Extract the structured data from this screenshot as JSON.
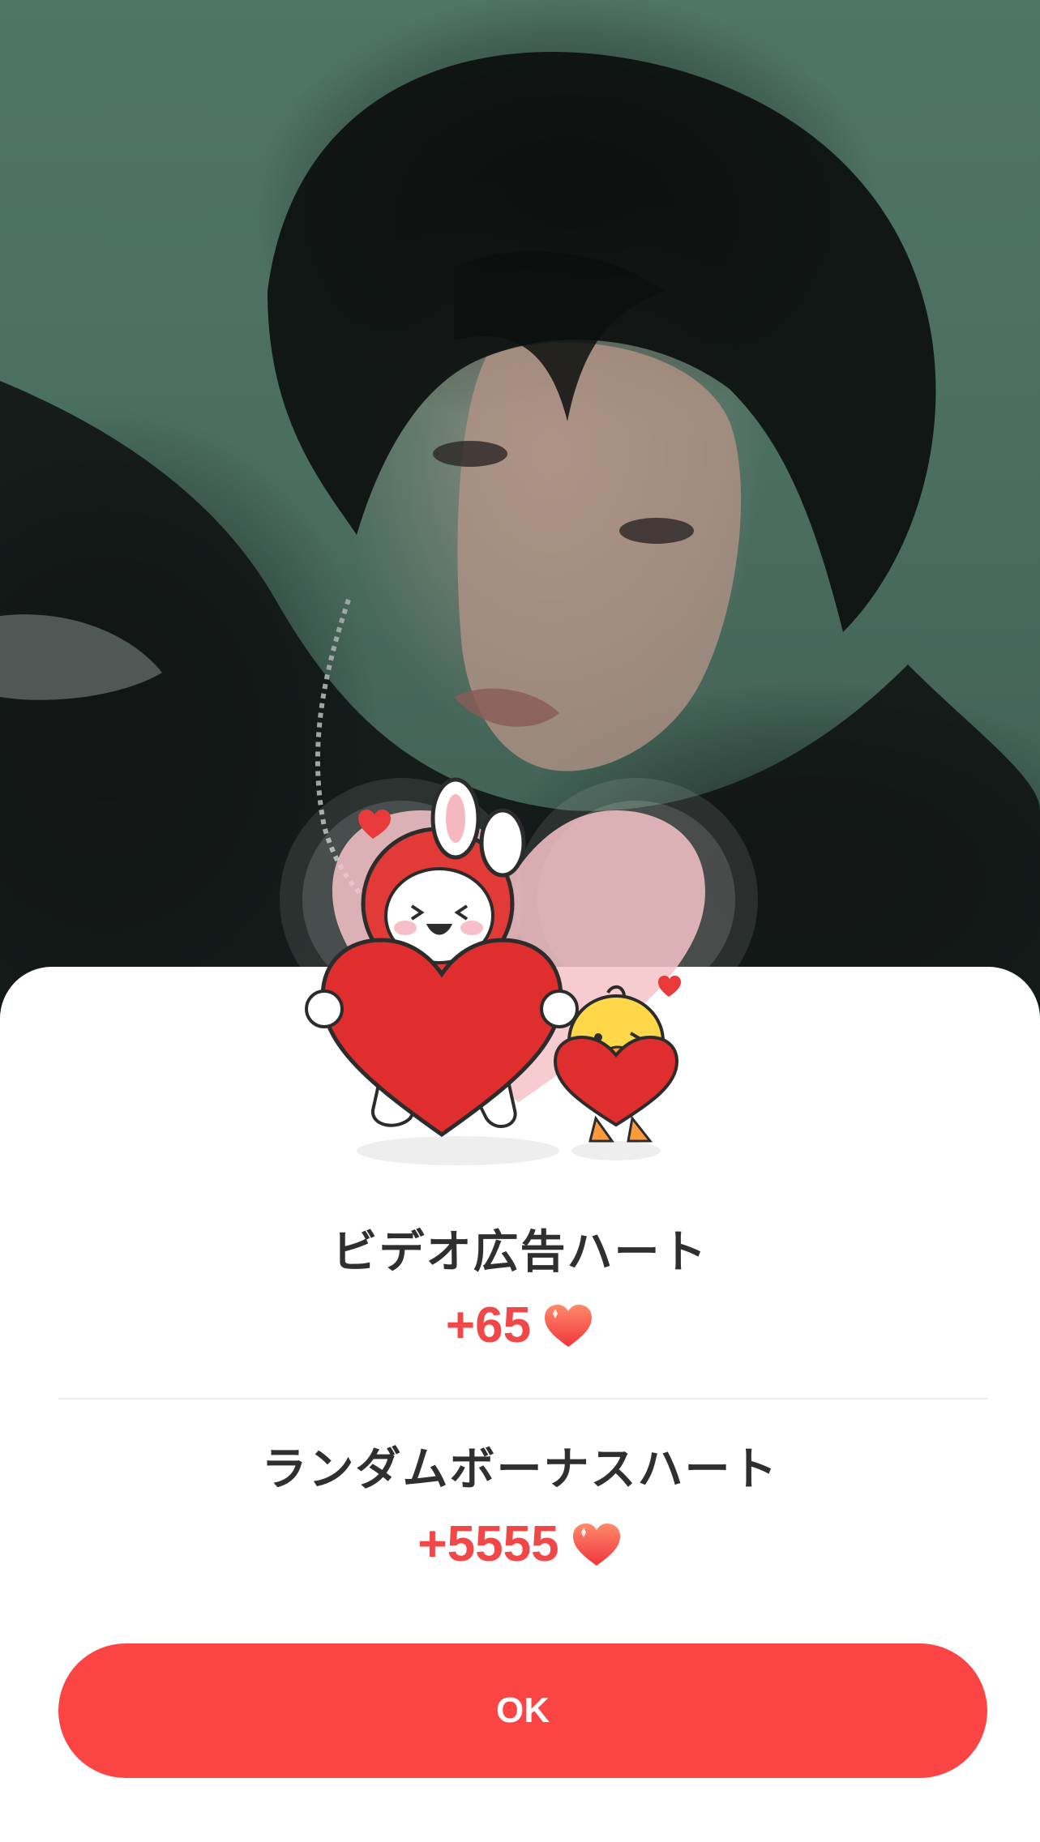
{
  "dialog": {
    "rewards": [
      {
        "label": "ビデオ広告ハート",
        "amount": "+65",
        "icon": "heart-icon"
      },
      {
        "label": "ランダムボーナスハート",
        "amount": "+5555",
        "icon": "heart-icon"
      }
    ],
    "ok_label": "OK"
  },
  "colors": {
    "accent": "#fb4545",
    "amount_text": "#f04848",
    "title_text": "#2f2f2f",
    "sheet_background": "#ffffff"
  }
}
